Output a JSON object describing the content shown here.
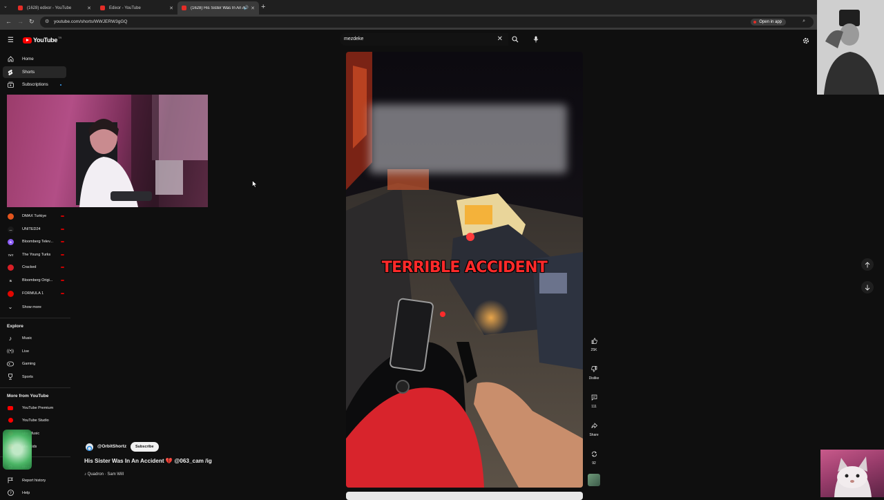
{
  "browser": {
    "tabs": [
      {
        "title": "(1628) edixor - YouTube",
        "active": false
      },
      {
        "title": "Edixor - YouTube",
        "active": false
      },
      {
        "title": "(1628) His Sister Was In An Ac",
        "active": true
      }
    ],
    "url": "youtube.com/shorts/WWJERW3gGQ",
    "open_in_app": "Open in app"
  },
  "youtube": {
    "logo_text": "YouTube",
    "logo_country": "TR",
    "search_query": "mezdeke"
  },
  "sidebar": {
    "main": [
      {
        "label": "Home",
        "icon": "home-icon",
        "active": false
      },
      {
        "label": "Shorts",
        "icon": "shorts-icon",
        "active": true
      },
      {
        "label": "Subscriptions",
        "icon": "subscriptions-icon",
        "active": false
      }
    ],
    "subscriptions": [
      {
        "label": "DMAX Turkiye",
        "color": "#e2541d",
        "glyph": ""
      },
      {
        "label": "UNITED24",
        "color": "#1a1a1a",
        "glyph": "—"
      },
      {
        "label": "Bloomberg Telev...",
        "color": "#8b5cf6",
        "glyph": "B"
      },
      {
        "label": "The Young Turks",
        "color": "#111111",
        "glyph": "TYT"
      },
      {
        "label": "Cracked",
        "color": "#d81f26",
        "glyph": ""
      },
      {
        "label": "Bloomberg Origi...",
        "color": "#111111",
        "glyph": "B"
      },
      {
        "label": "FORMULA 1",
        "color": "#e10600",
        "glyph": ""
      }
    ],
    "show_more": "Show more",
    "explore_title": "Explore",
    "explore": [
      {
        "label": "Music",
        "icon": "music-icon"
      },
      {
        "label": "Live",
        "icon": "live-icon"
      },
      {
        "label": "Gaming",
        "icon": "gaming-icon"
      },
      {
        "label": "Sports",
        "icon": "sports-icon"
      }
    ],
    "more_title": "More from YouTube",
    "more": [
      {
        "label": "YouTube Premium",
        "color": "#ff0000"
      },
      {
        "label": "YouTube Studio",
        "color": "#ff0000"
      },
      {
        "label": "ube Music",
        "color": "#ff0000"
      },
      {
        "label": "ube Kids",
        "color": "#ff0000"
      }
    ],
    "footer": [
      {
        "label": "ttings",
        "icon": "settings-icon"
      },
      {
        "label": "Report history",
        "icon": "flag-icon"
      },
      {
        "label": "Help",
        "icon": "help-icon"
      }
    ]
  },
  "short": {
    "overlay_text": "TERRIBLE ACCIDENT",
    "channel": "@OrbitShortz",
    "subscribe_label": "Subscribe",
    "title_before": "His Sister Was In An Accident ",
    "title_heart": "💔",
    "title_after": " @063_cam /ig",
    "music": "Quadron · Sam Will",
    "likes": "25K",
    "dislike_label": "Dislike",
    "comments": "111",
    "share_label": "Share",
    "remix_count": "92"
  }
}
